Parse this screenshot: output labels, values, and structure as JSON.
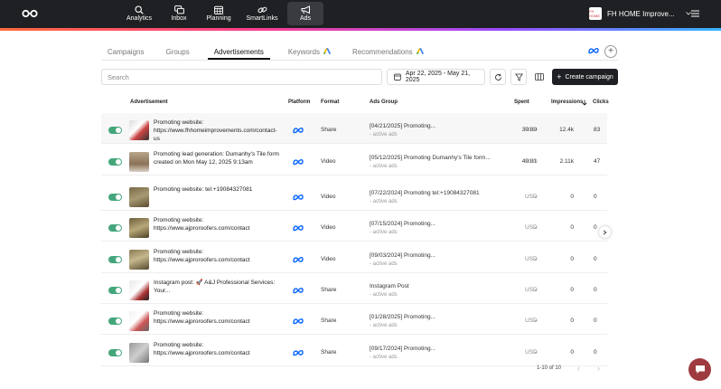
{
  "topbar": {
    "nav": [
      {
        "label": "Analytics",
        "icon": "analytics-icon"
      },
      {
        "label": "Inbox",
        "icon": "inbox-icon"
      },
      {
        "label": "Planning",
        "icon": "calendar-icon"
      },
      {
        "label": "SmartLinks",
        "icon": "link-icon"
      },
      {
        "label": "Ads",
        "icon": "megaphone-icon"
      }
    ],
    "account_name": "FH HOME Improve...",
    "account_logo_text": "FH HOME"
  },
  "tabs": [
    {
      "label": "Campaigns"
    },
    {
      "label": "Groups"
    },
    {
      "label": "Advertisements"
    },
    {
      "label": "Keywords"
    },
    {
      "label": "Recommendations"
    }
  ],
  "toolbar": {
    "search_placeholder": "Search",
    "date_range": "Apr 22, 2025 - May 21, 2025",
    "create_label": "Create campaign"
  },
  "table": {
    "headers": {
      "advertisement": "Advertisement",
      "platform": "Platform",
      "format": "Format",
      "ads_group": "Ads Group",
      "spent": "Spent",
      "impressions": "Impressions",
      "clicks": "Clicks"
    },
    "rows": [
      {
        "ad": "Promoting website: https://www.fhhomeimprovements.com/contact-us",
        "format": "Share",
        "group": "[04/21/2025] Promoting...",
        "group_sub": "- active ads",
        "spent": "39.89",
        "currency": "USD",
        "impressions": "12.4k",
        "clicks": "83"
      },
      {
        "ad": "Promoting lead generation: Dumanhy's Tile form created on Mon May 12, 2025 9:13am",
        "format": "Video",
        "group": "[05/12/2025] Promoting Dumanhy's Tile form...",
        "group_sub": "- active ads",
        "spent": "49.81",
        "currency": "USD",
        "impressions": "2.11k",
        "clicks": "47"
      },
      {
        "ad": "Promoting website: tel:+19084327081",
        "format": "Video",
        "group": "[07/22/2024] Promoting tel:+19084327081",
        "group_sub": "- active ads",
        "spent": "-",
        "currency": "USD",
        "impressions": "0",
        "clicks": "0"
      },
      {
        "ad": "Promoting website: https://www.ajproroofers.com/contact",
        "format": "Video",
        "group": "[07/15/2024] Promoting...",
        "group_sub": "- active ads",
        "spent": "-",
        "currency": "USD",
        "impressions": "0",
        "clicks": "0"
      },
      {
        "ad": "Promoting website: https://www.ajproroofers.com/contact",
        "format": "Video",
        "group": "[09/03/2024] Promoting...",
        "group_sub": "- active ads",
        "spent": "-",
        "currency": "USD",
        "impressions": "0",
        "clicks": "0"
      },
      {
        "ad": "Instagram post: 🚀 A&J Professional Services: Your...",
        "format": "Share",
        "group": "Instagram Post",
        "group_sub": "- active ads",
        "spent": "-",
        "currency": "USD",
        "impressions": "0",
        "clicks": "0"
      },
      {
        "ad": "Promoting website: https://www.ajproroofers.com/contact",
        "format": "Share",
        "group": "[01/28/2025] Promoting...",
        "group_sub": "- active ads",
        "spent": "-",
        "currency": "USD",
        "impressions": "0",
        "clicks": "0"
      },
      {
        "ad": "Promoting website: https://www.ajproroofers.com/contact",
        "format": "Share",
        "group": "[09/17/2024] Promoting...",
        "group_sub": "- active ads",
        "spent": "-",
        "currency": "USD",
        "impressions": "0",
        "clicks": "0"
      }
    ]
  },
  "pagination": {
    "label": "1-10 of 10"
  },
  "colors": {
    "toggle_on": "#45a67c",
    "meta_blue": "#0866ff",
    "chat": "#9e3b3e"
  }
}
